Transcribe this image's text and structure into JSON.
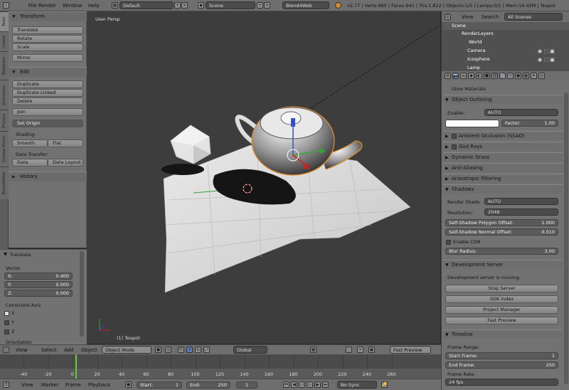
{
  "topbar": {
    "menus": [
      "File",
      "Render",
      "Window",
      "Help"
    ],
    "layout": "Default",
    "scene": "Scene",
    "engine": "Blend4Web",
    "stats": "v2.77 | Verts:985 | Faces:941 | Tris:1,822 | Objects:1/5 | Lamps:0/1 | Mem:19.42M | Teapot"
  },
  "tabs": [
    "Tools",
    "Create",
    "Relations",
    "Animation",
    "Physics",
    "Grease Pencil",
    "Blend4Web"
  ],
  "toolshelf": {
    "transform": {
      "title": "Transform",
      "buttons": [
        "Translate",
        "Rotate",
        "Scale",
        "Mirror"
      ]
    },
    "edit": {
      "title": "Edit",
      "buttons": [
        "Duplicate",
        "Duplicate Linked",
        "Delete",
        "Join"
      ],
      "set_origin": "Set Origin",
      "shading_label": "Shading:",
      "smooth": "Smooth",
      "flat": "Flat",
      "data_transfer_label": "Data Transfer:",
      "data": "Data",
      "data_layout": "Data Layout"
    },
    "history": "History"
  },
  "operator": {
    "title": "Translate",
    "vector_label": "Vector",
    "x": "X:",
    "xv": "0.400",
    "y": "Y:",
    "yv": "0.000",
    "z": "Z:",
    "zv": "0.000",
    "constraint_label": "Constraint Axis",
    "ax": "X",
    "ay": "Y",
    "az": "Z",
    "orientation": "Orientation"
  },
  "viewport": {
    "label": "User Persp",
    "object": "(1) Teapot"
  },
  "view3d_header": {
    "menus": [
      "View",
      "Select",
      "Add",
      "Object"
    ],
    "mode": "Object Mode",
    "orientation": "Global",
    "fast_preview": "Fast Preview"
  },
  "timeline": {
    "ticks": [
      "-40",
      "-20",
      "0",
      "20",
      "40",
      "60",
      "80",
      "100",
      "120",
      "140",
      "160",
      "180",
      "200",
      "220",
      "240",
      "260"
    ],
    "current": "0"
  },
  "timeline_header": {
    "menus": [
      "View",
      "Marker",
      "Frame",
      "Playback"
    ],
    "start_label": "Start:",
    "start": "1",
    "end_label": "End:",
    "end": "250",
    "frame": "1",
    "sync": "No Sync"
  },
  "outliner": {
    "menus": [
      "View",
      "Search"
    ],
    "filter": "All Scenes",
    "items": [
      "Scene",
      "RenderLayers",
      "World",
      "Camera",
      "Icosphere",
      "Lamp"
    ]
  },
  "properties": {
    "glow": "Glow Materials",
    "outlining": {
      "title": "Object Outlining",
      "enable_label": "Enable:",
      "enable": "AUTO",
      "factor_label": "Factor:",
      "factor": "1.00"
    },
    "sections": [
      "Ambient Occlusion (SSAO)",
      "God Rays",
      "Dynamic Grass",
      "Anti-Aliasing",
      "Anisotropic Filtering"
    ],
    "shadows": {
      "title": "Shadows",
      "render_label": "Render Shado",
      "render": "AUTO",
      "res_label": "Resolution:",
      "res": "2048",
      "poly_label": "Self-Shadow Polygon Offset:",
      "poly": "1.000",
      "normal_label": "Self-Shadow Normal Offset:",
      "normal": "0.010",
      "csm": "Enable CSM",
      "blur_label": "Blur Radius:",
      "blur": "3.00"
    },
    "devserver": {
      "title": "Development Server",
      "status": "Development server is running.",
      "buttons": [
        "Stop Server",
        "SDK Index",
        "Project Manager",
        "Fast Preview"
      ]
    },
    "timeline": {
      "title": "Timeline",
      "range_label": "Frame Range:",
      "start_label": "Start Frame:",
      "start": "1",
      "end_label": "End Frame:",
      "end": "250",
      "rate_label": "Frame Rate:",
      "rate": "24 fps"
    }
  }
}
